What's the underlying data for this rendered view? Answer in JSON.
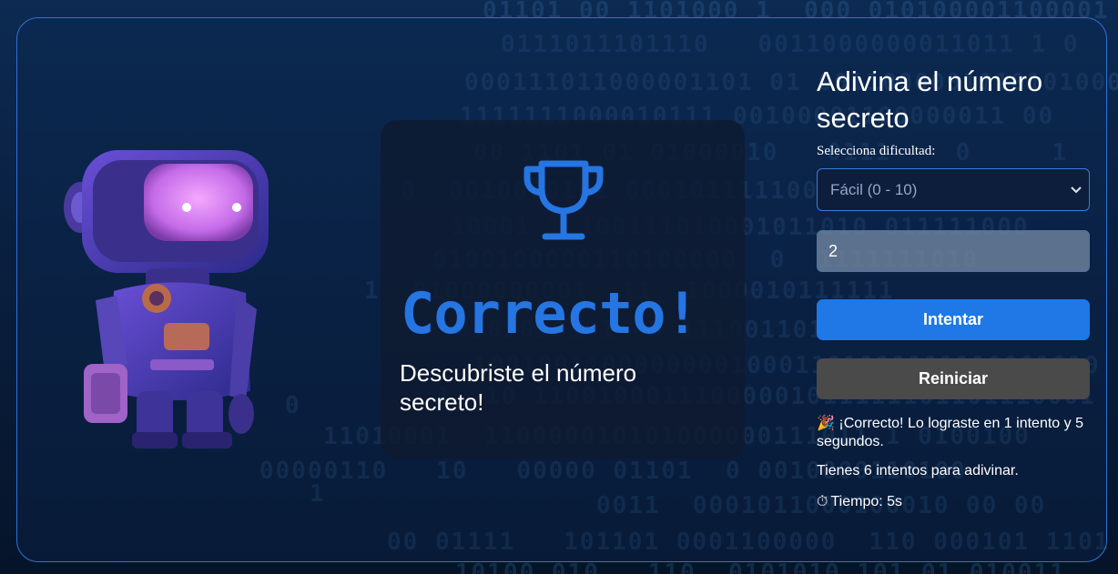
{
  "game": {
    "title": "Adivina el número secreto",
    "difficulty_label": "Selecciona dificultad:",
    "difficulty_selected": "Fácil (0 - 10)",
    "guess_value": "2",
    "try_button": "Intentar",
    "reset_button": "Reiniciar"
  },
  "result": {
    "heading": "Correcto!",
    "subtext": "Descubriste el número secreto!"
  },
  "messages": {
    "success_icon": "🎉",
    "success": "¡Correcto! Lo lograste en 1 intento y 5 segundos.",
    "attempts": "Tienes 6 intentos para adivinar.",
    "timer_icon": "⏱",
    "timer": "Tiempo: 5s"
  },
  "icons": {
    "trophy": "trophy-icon",
    "robot": "robot-illustration",
    "select_arrow": "chevron-down-icon"
  },
  "colors": {
    "accent": "#2575e2",
    "button_primary": "#1f78e6",
    "button_secondary": "#4a4a4a",
    "border": "#2f72d6"
  }
}
